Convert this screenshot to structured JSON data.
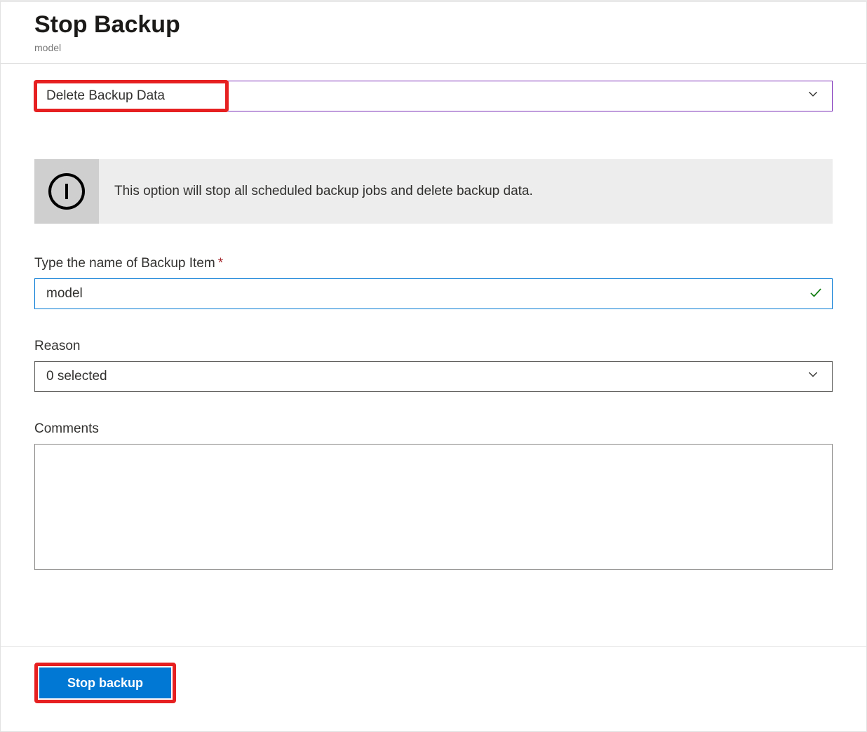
{
  "header": {
    "title": "Stop Backup",
    "subtitle": "model"
  },
  "action_dropdown": {
    "selected": "Delete Backup Data"
  },
  "info_banner": {
    "text": "This option will stop all scheduled backup jobs and delete backup data."
  },
  "fields": {
    "backup_item_name": {
      "label": "Type the name of Backup Item",
      "value": "model"
    },
    "reason": {
      "label": "Reason",
      "selected": "0 selected"
    },
    "comments": {
      "label": "Comments",
      "value": ""
    }
  },
  "footer": {
    "stop_backup_label": "Stop backup"
  }
}
